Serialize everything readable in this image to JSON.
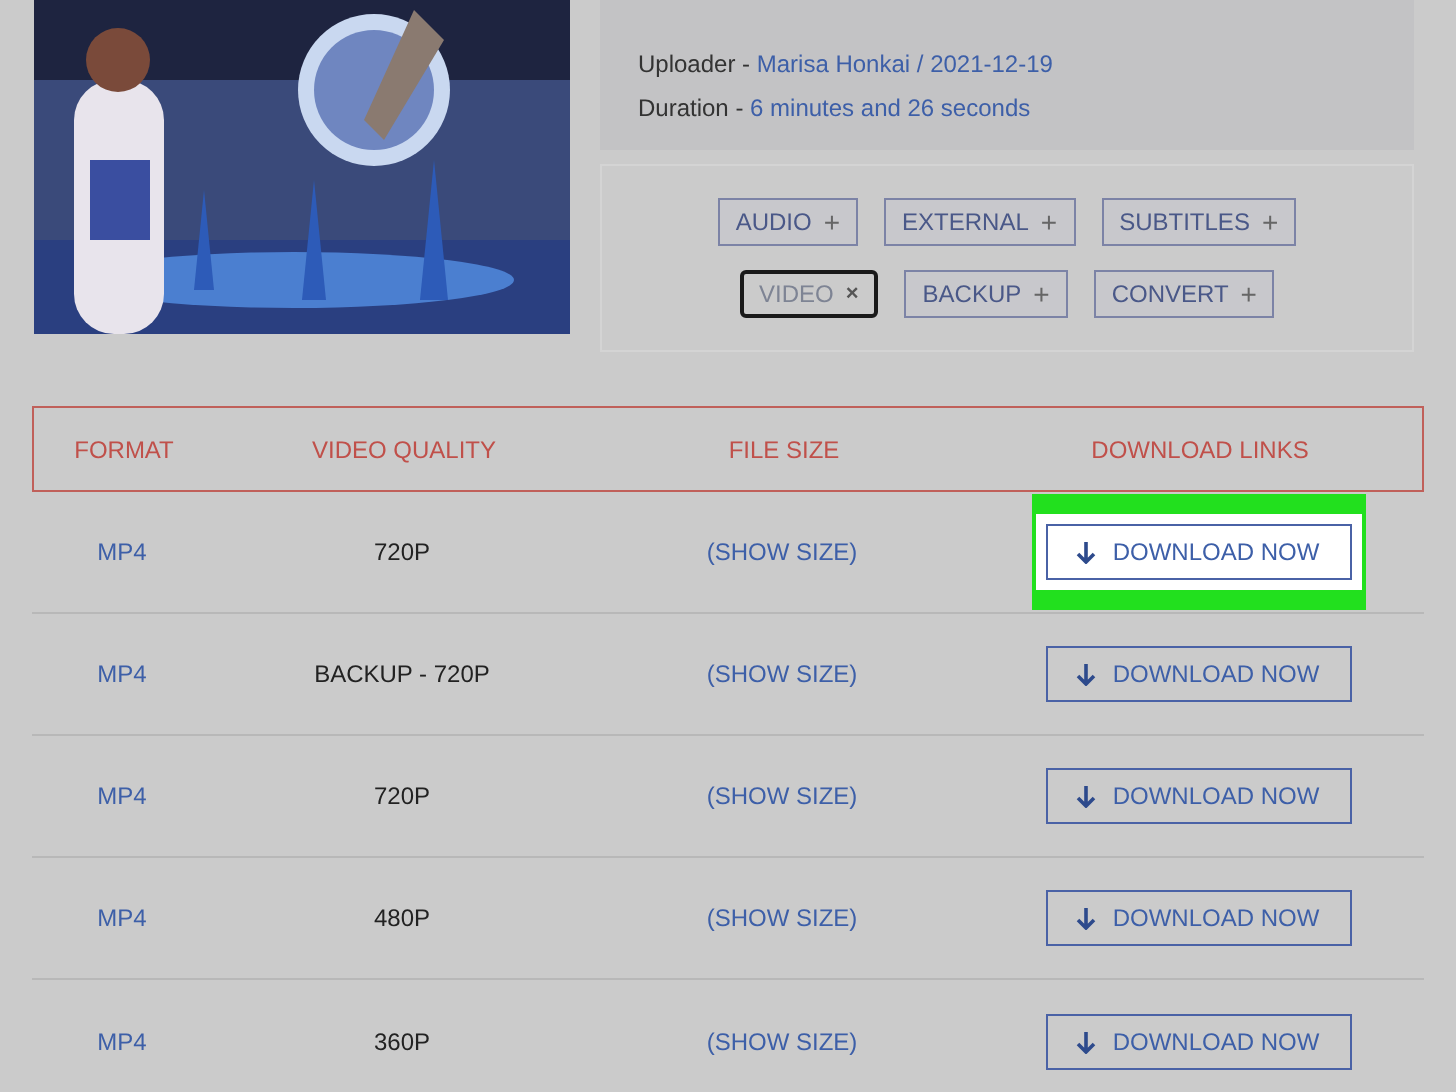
{
  "info": [
    {
      "label": "Uploader - ",
      "value": "Marisa Honkai / 2021-12-19"
    },
    {
      "label": "Duration - ",
      "value": "6 minutes and 26 seconds"
    }
  ],
  "filters": [
    {
      "label": "AUDIO",
      "icon": "+",
      "selected": false
    },
    {
      "label": "EXTERNAL",
      "icon": "+",
      "selected": false
    },
    {
      "label": "SUBTITLES",
      "icon": "+",
      "selected": false
    },
    {
      "label": "VIDEO",
      "icon": "×",
      "selected": true
    },
    {
      "label": "BACKUP",
      "icon": "+",
      "selected": false
    },
    {
      "label": "CONVERT",
      "icon": "+",
      "selected": false
    }
  ],
  "table": {
    "columns": [
      "FORMAT",
      "VIDEO QUALITY",
      "FILE SIZE",
      "DOWNLOAD LINKS"
    ],
    "rows": [
      {
        "format": "MP4",
        "quality": "720P",
        "size": "(SHOW SIZE)",
        "button": "DOWNLOAD NOW",
        "highlighted": true
      },
      {
        "format": "MP4",
        "quality": "BACKUP - 720P",
        "size": "(SHOW SIZE)",
        "button": "DOWNLOAD NOW",
        "highlighted": false
      },
      {
        "format": "MP4",
        "quality": "720P",
        "size": "(SHOW SIZE)",
        "button": "DOWNLOAD NOW",
        "highlighted": false
      },
      {
        "format": "MP4",
        "quality": "480P",
        "size": "(SHOW SIZE)",
        "button": "DOWNLOAD NOW",
        "highlighted": false
      },
      {
        "format": "MP4",
        "quality": "360P",
        "size": "(SHOW SIZE)",
        "button": "DOWNLOAD NOW",
        "highlighted": false
      }
    ]
  }
}
